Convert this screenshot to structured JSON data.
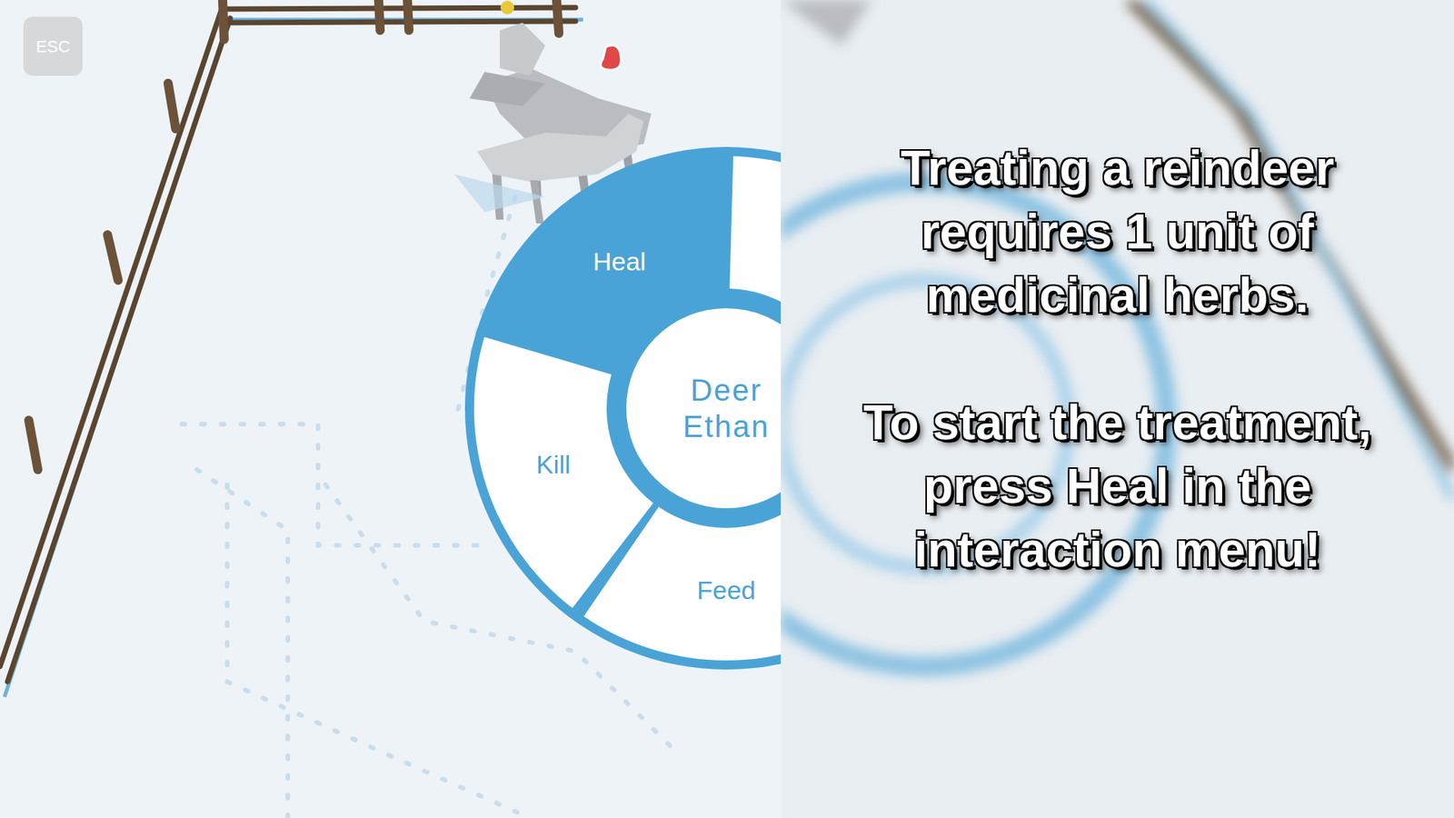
{
  "esc_button": "ESC",
  "interaction_menu": {
    "target": {
      "species": "Deer",
      "name": "Ethan"
    },
    "options": [
      {
        "label": "Heal",
        "selected": true
      },
      {
        "label": "Kill",
        "selected": false
      },
      {
        "label": "Feed",
        "selected": false
      }
    ]
  },
  "tutorial": {
    "paragraphs": [
      "Treating a reindeer requires 1 unit of medicinal herbs.",
      "To start the treatment, press Heal in the interaction menu!"
    ]
  }
}
